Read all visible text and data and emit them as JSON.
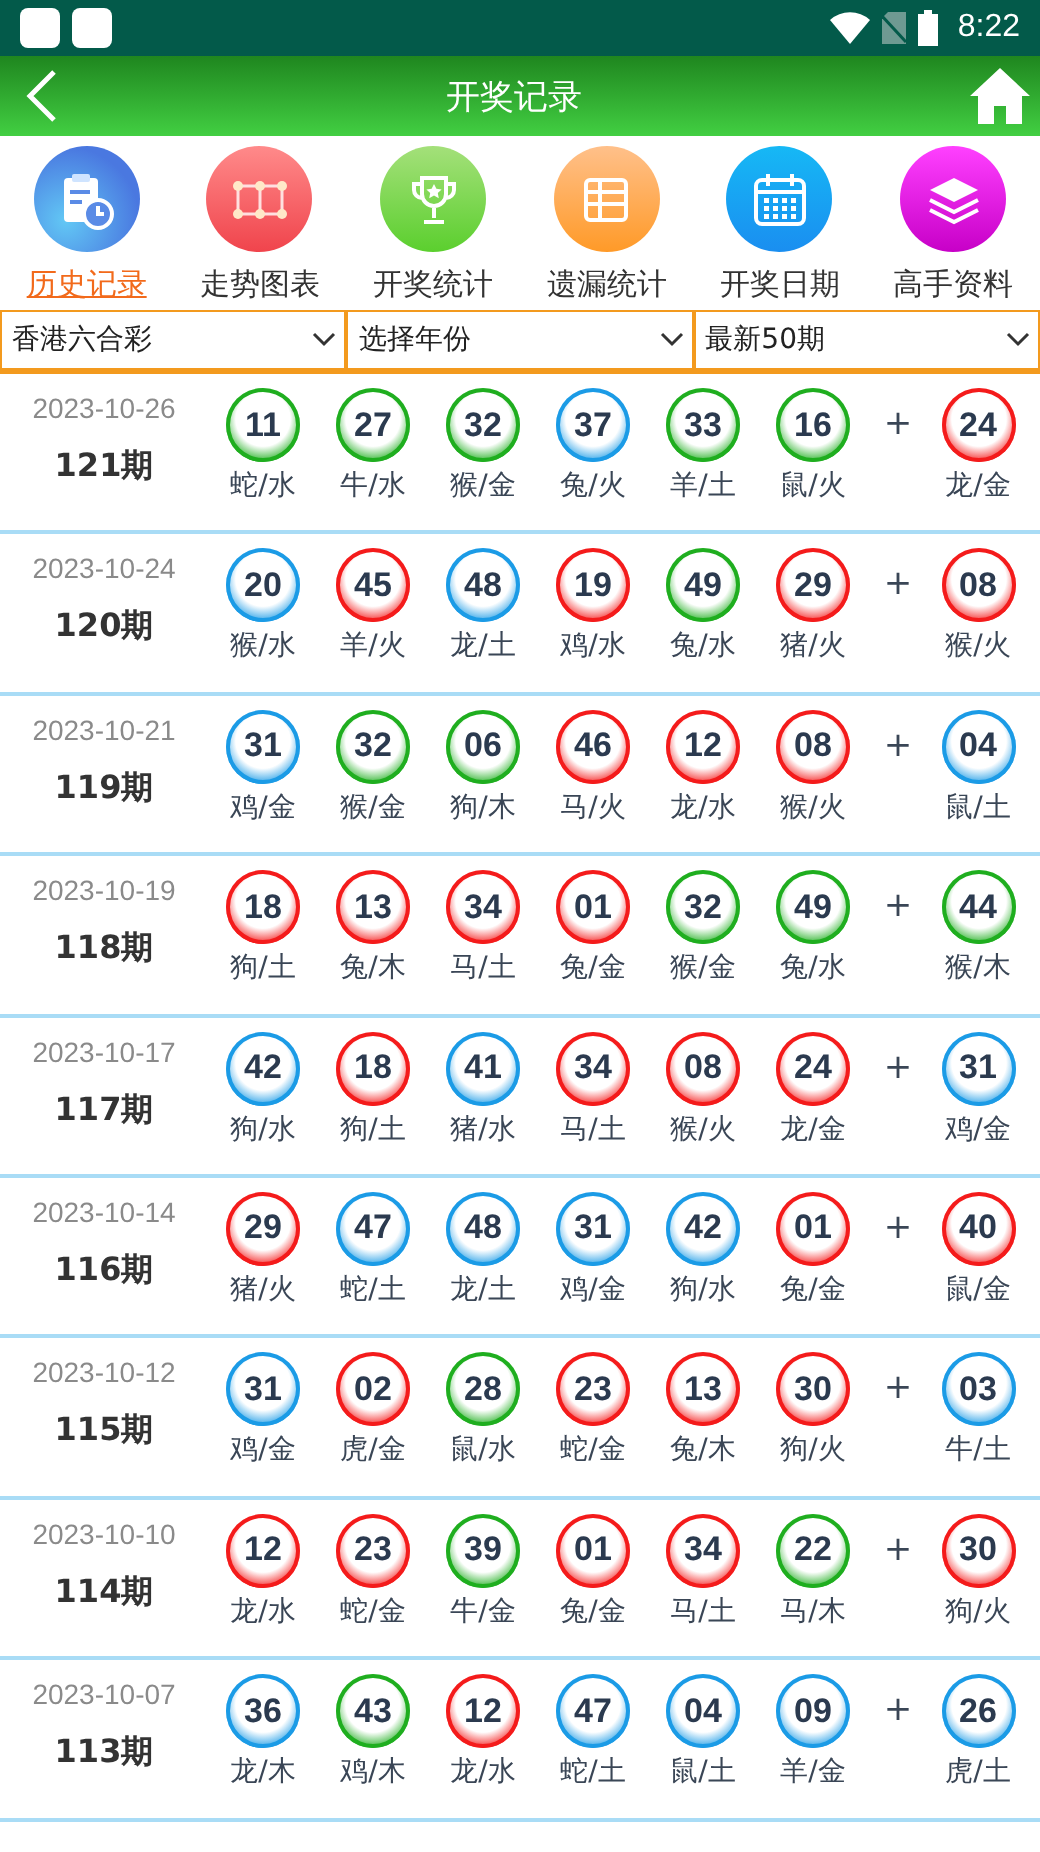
{
  "status_bar": {
    "time": "8:22"
  },
  "header": {
    "title": "开奖记录"
  },
  "nav": [
    {
      "kind": "history",
      "label": "历史记录",
      "selected": true
    },
    {
      "kind": "trend",
      "label": "走势图表",
      "selected": false
    },
    {
      "kind": "stats",
      "label": "开奖统计",
      "selected": false
    },
    {
      "kind": "missing",
      "label": "遗漏统计",
      "selected": false
    },
    {
      "kind": "calendar",
      "label": "开奖日期",
      "selected": false
    },
    {
      "kind": "expert",
      "label": "高手资料",
      "selected": false
    }
  ],
  "filters": [
    {
      "value": "香港六合彩"
    },
    {
      "value": "选择年份"
    },
    {
      "value": "最新50期"
    }
  ],
  "draws": [
    {
      "date": "2023-10-26",
      "issue": "121期",
      "plus": "+",
      "balls": [
        {
          "number": "11",
          "zodiac": "蛇/水",
          "color": "#1fae1f"
        },
        {
          "number": "27",
          "zodiac": "牛/水",
          "color": "#1fae1f"
        },
        {
          "number": "32",
          "zodiac": "猴/金",
          "color": "#1fae1f"
        },
        {
          "number": "37",
          "zodiac": "兔/火",
          "color": "#1b9be6"
        },
        {
          "number": "33",
          "zodiac": "羊/土",
          "color": "#1fae1f"
        },
        {
          "number": "16",
          "zodiac": "鼠/火",
          "color": "#1fae1f"
        }
      ],
      "special": {
        "number": "24",
        "zodiac": "龙/金",
        "color": "#f41b1b"
      }
    },
    {
      "date": "2023-10-24",
      "issue": "120期",
      "plus": "+",
      "balls": [
        {
          "number": "20",
          "zodiac": "猴/水",
          "color": "#1b9be6"
        },
        {
          "number": "45",
          "zodiac": "羊/火",
          "color": "#f41b1b"
        },
        {
          "number": "48",
          "zodiac": "龙/土",
          "color": "#1b9be6"
        },
        {
          "number": "19",
          "zodiac": "鸡/水",
          "color": "#f41b1b"
        },
        {
          "number": "49",
          "zodiac": "兔/水",
          "color": "#1fae1f"
        },
        {
          "number": "29",
          "zodiac": "猪/火",
          "color": "#f41b1b"
        }
      ],
      "special": {
        "number": "08",
        "zodiac": "猴/火",
        "color": "#f41b1b"
      }
    },
    {
      "date": "2023-10-21",
      "issue": "119期",
      "plus": "+",
      "balls": [
        {
          "number": "31",
          "zodiac": "鸡/金",
          "color": "#1b9be6"
        },
        {
          "number": "32",
          "zodiac": "猴/金",
          "color": "#1fae1f"
        },
        {
          "number": "06",
          "zodiac": "狗/木",
          "color": "#1fae1f"
        },
        {
          "number": "46",
          "zodiac": "马/火",
          "color": "#f41b1b"
        },
        {
          "number": "12",
          "zodiac": "龙/水",
          "color": "#f41b1b"
        },
        {
          "number": "08",
          "zodiac": "猴/火",
          "color": "#f41b1b"
        }
      ],
      "special": {
        "number": "04",
        "zodiac": "鼠/土",
        "color": "#1b9be6"
      }
    },
    {
      "date": "2023-10-19",
      "issue": "118期",
      "plus": "+",
      "balls": [
        {
          "number": "18",
          "zodiac": "狗/土",
          "color": "#f41b1b"
        },
        {
          "number": "13",
          "zodiac": "兔/木",
          "color": "#f41b1b"
        },
        {
          "number": "34",
          "zodiac": "马/土",
          "color": "#f41b1b"
        },
        {
          "number": "01",
          "zodiac": "兔/金",
          "color": "#f41b1b"
        },
        {
          "number": "32",
          "zodiac": "猴/金",
          "color": "#1fae1f"
        },
        {
          "number": "49",
          "zodiac": "兔/水",
          "color": "#1fae1f"
        }
      ],
      "special": {
        "number": "44",
        "zodiac": "猴/木",
        "color": "#1fae1f"
      }
    },
    {
      "date": "2023-10-17",
      "issue": "117期",
      "plus": "+",
      "balls": [
        {
          "number": "42",
          "zodiac": "狗/水",
          "color": "#1b9be6"
        },
        {
          "number": "18",
          "zodiac": "狗/土",
          "color": "#f41b1b"
        },
        {
          "number": "41",
          "zodiac": "猪/水",
          "color": "#1b9be6"
        },
        {
          "number": "34",
          "zodiac": "马/土",
          "color": "#f41b1b"
        },
        {
          "number": "08",
          "zodiac": "猴/火",
          "color": "#f41b1b"
        },
        {
          "number": "24",
          "zodiac": "龙/金",
          "color": "#f41b1b"
        }
      ],
      "special": {
        "number": "31",
        "zodiac": "鸡/金",
        "color": "#1b9be6"
      }
    },
    {
      "date": "2023-10-14",
      "issue": "116期",
      "plus": "+",
      "balls": [
        {
          "number": "29",
          "zodiac": "猪/火",
          "color": "#f41b1b"
        },
        {
          "number": "47",
          "zodiac": "蛇/土",
          "color": "#1b9be6"
        },
        {
          "number": "48",
          "zodiac": "龙/土",
          "color": "#1b9be6"
        },
        {
          "number": "31",
          "zodiac": "鸡/金",
          "color": "#1b9be6"
        },
        {
          "number": "42",
          "zodiac": "狗/水",
          "color": "#1b9be6"
        },
        {
          "number": "01",
          "zodiac": "兔/金",
          "color": "#f41b1b"
        }
      ],
      "special": {
        "number": "40",
        "zodiac": "鼠/金",
        "color": "#f41b1b"
      }
    },
    {
      "date": "2023-10-12",
      "issue": "115期",
      "plus": "+",
      "balls": [
        {
          "number": "31",
          "zodiac": "鸡/金",
          "color": "#1b9be6"
        },
        {
          "number": "02",
          "zodiac": "虎/金",
          "color": "#f41b1b"
        },
        {
          "number": "28",
          "zodiac": "鼠/水",
          "color": "#1fae1f"
        },
        {
          "number": "23",
          "zodiac": "蛇/金",
          "color": "#f41b1b"
        },
        {
          "number": "13",
          "zodiac": "兔/木",
          "color": "#f41b1b"
        },
        {
          "number": "30",
          "zodiac": "狗/火",
          "color": "#f41b1b"
        }
      ],
      "special": {
        "number": "03",
        "zodiac": "牛/土",
        "color": "#1b9be6"
      }
    },
    {
      "date": "2023-10-10",
      "issue": "114期",
      "plus": "+",
      "balls": [
        {
          "number": "12",
          "zodiac": "龙/水",
          "color": "#f41b1b"
        },
        {
          "number": "23",
          "zodiac": "蛇/金",
          "color": "#f41b1b"
        },
        {
          "number": "39",
          "zodiac": "牛/金",
          "color": "#1fae1f"
        },
        {
          "number": "01",
          "zodiac": "兔/金",
          "color": "#f41b1b"
        },
        {
          "number": "34",
          "zodiac": "马/土",
          "color": "#f41b1b"
        },
        {
          "number": "22",
          "zodiac": "马/木",
          "color": "#1fae1f"
        }
      ],
      "special": {
        "number": "30",
        "zodiac": "狗/火",
        "color": "#f41b1b"
      }
    },
    {
      "date": "2023-10-07",
      "issue": "113期",
      "plus": "+",
      "balls": [
        {
          "number": "36",
          "zodiac": "龙/木",
          "color": "#1b9be6"
        },
        {
          "number": "43",
          "zodiac": "鸡/木",
          "color": "#1fae1f"
        },
        {
          "number": "12",
          "zodiac": "龙/水",
          "color": "#f41b1b"
        },
        {
          "number": "47",
          "zodiac": "蛇/土",
          "color": "#1b9be6"
        },
        {
          "number": "04",
          "zodiac": "鼠/土",
          "color": "#1b9be6"
        },
        {
          "number": "09",
          "zodiac": "羊/金",
          "color": "#1b9be6"
        }
      ],
      "special": {
        "number": "26",
        "zodiac": "虎/土",
        "color": "#1b9be6"
      }
    }
  ]
}
